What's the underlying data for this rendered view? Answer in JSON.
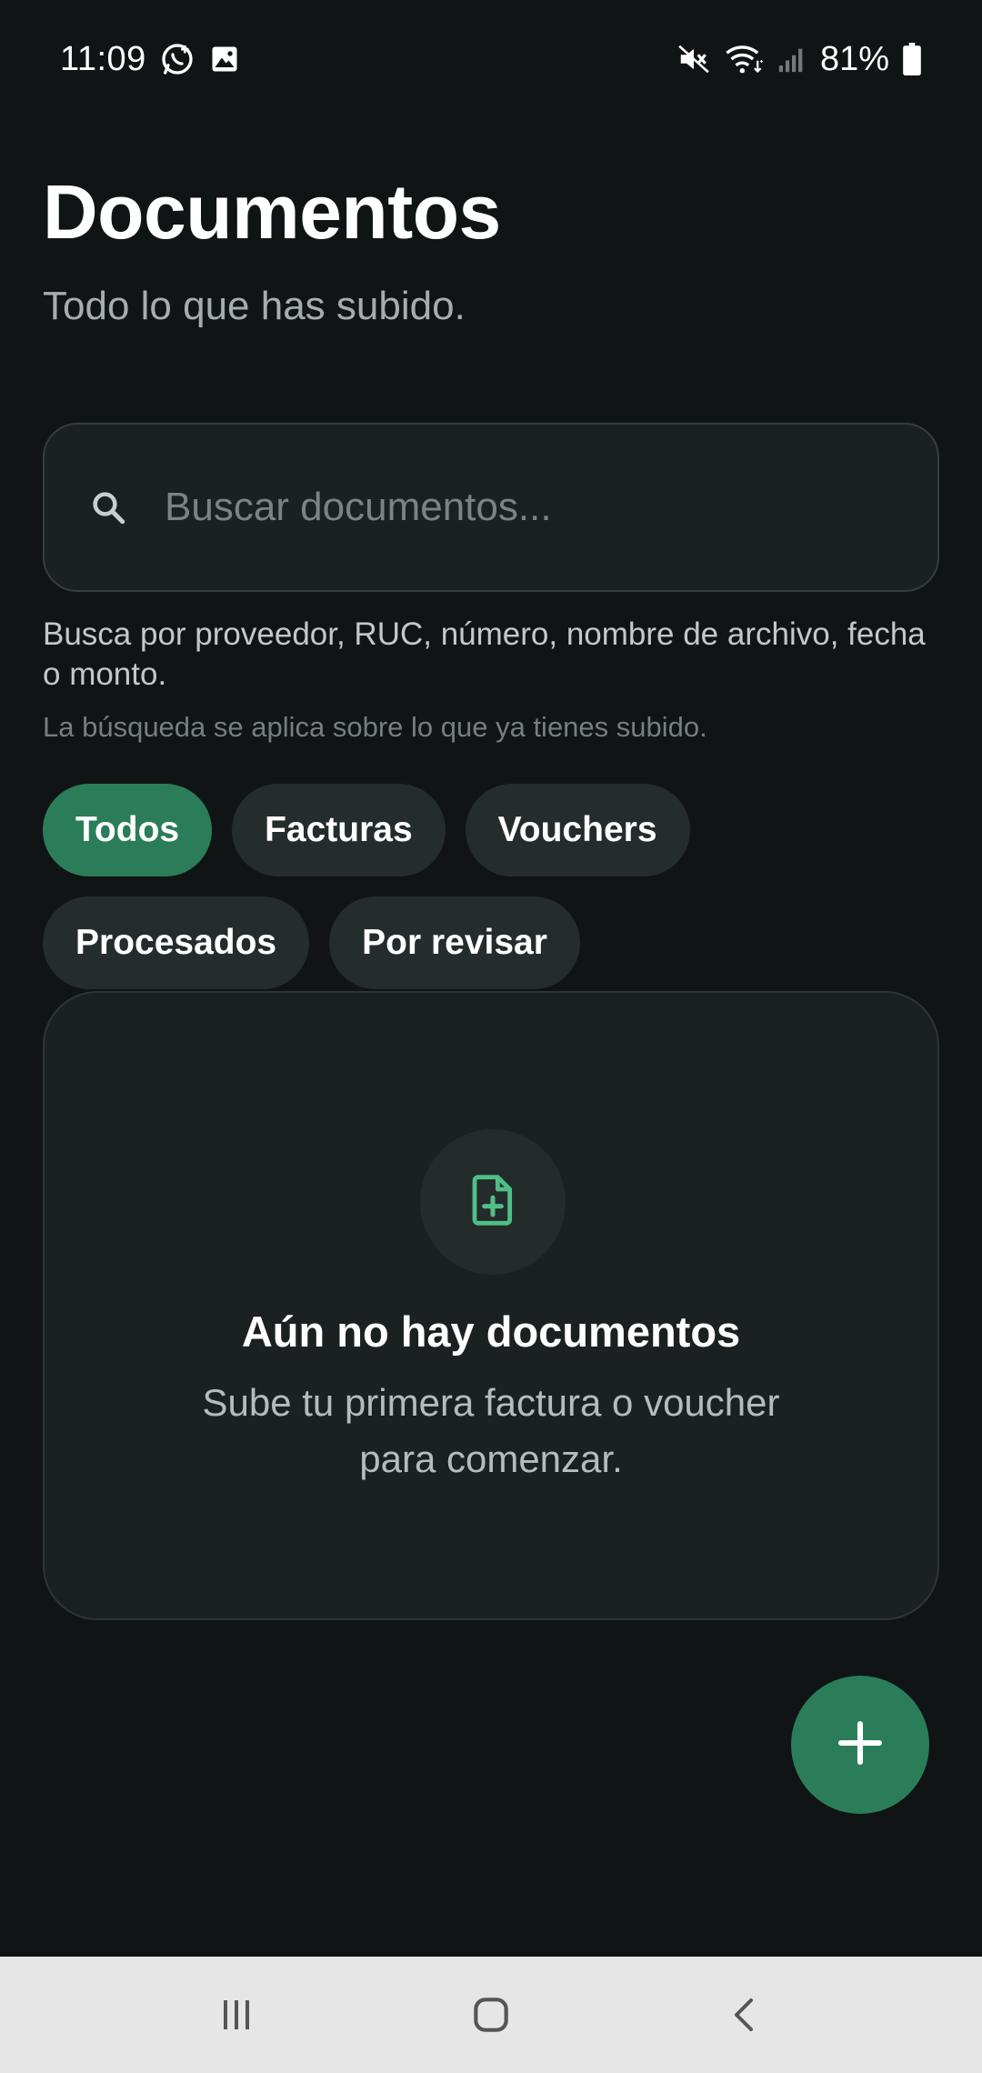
{
  "status_bar": {
    "time": "11:09",
    "battery": "81%",
    "icons_left": [
      "whatsapp-icon",
      "image-icon"
    ],
    "icons_right": [
      "mute-icon",
      "wifi-icon",
      "signal-icon",
      "battery-icon"
    ]
  },
  "header": {
    "title": "Documentos",
    "subtitle": "Todo lo que has subido."
  },
  "search": {
    "placeholder": "Buscar documentos...",
    "value": "",
    "hint": "Busca por proveedor, RUC, número, nombre de archivo, fecha o monto.",
    "hint_secondary": "La búsqueda se aplica sobre lo que ya tienes subido."
  },
  "filters": [
    {
      "label": "Todos",
      "selected": true
    },
    {
      "label": "Facturas",
      "selected": false
    },
    {
      "label": "Vouchers",
      "selected": false
    },
    {
      "label": "Procesados",
      "selected": false
    },
    {
      "label": "Por revisar",
      "selected": false
    }
  ],
  "empty_state": {
    "icon": "file-add-icon",
    "title": "Aún no hay documentos",
    "description_line1": "Sube tu primera factura o voucher",
    "description_line2": "para comenzar."
  },
  "fab": {
    "icon": "plus-icon"
  },
  "colors": {
    "accent": "#2a7d58",
    "icon_accent": "#4fbf88",
    "background": "#101414",
    "surface": "#1b2121"
  },
  "nav": {
    "items": [
      "recent-apps-icon",
      "home-icon",
      "back-icon"
    ]
  }
}
